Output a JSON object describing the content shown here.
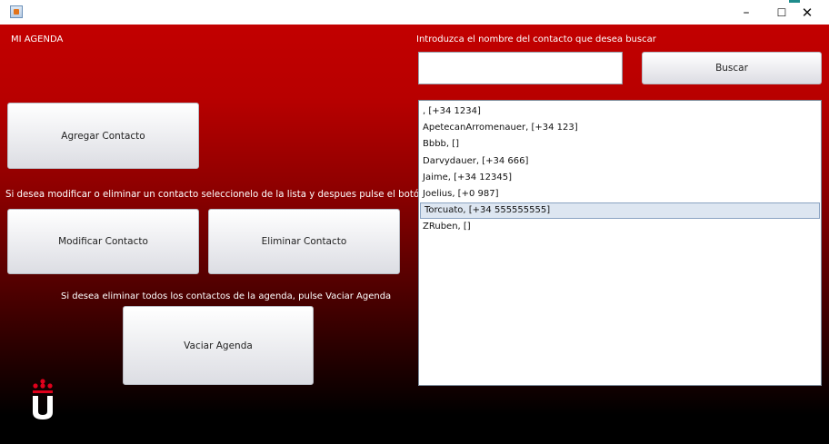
{
  "window": {
    "min_icon": "–",
    "max_icon": "☐",
    "close_icon": "✕"
  },
  "app_title": "MI AGENDA",
  "search": {
    "prompt": "Introduzca el nombre del contacto que desea buscar",
    "value": "",
    "button": "Buscar"
  },
  "buttons": {
    "add": "Agregar Contacto",
    "modify": "Modificar Contacto",
    "delete": "Eliminar Contacto",
    "empty": "Vaciar Agenda"
  },
  "instructions": {
    "modify_delete": "Si desea modificar o eliminar un contacto seleccionelo de la lista y despues pulse el botón",
    "empty": "Si desea eliminar todos los contactos de la agenda, pulse Vaciar Agenda"
  },
  "contacts": [
    ", [+34 1234]",
    "ApetecanArromenauer, [+34 123]",
    "Bbbb, []",
    "Darvydauer, [+34 666]",
    "Jaime, [+34 12345]",
    "Joelius, [+0 987]",
    "Torcuato, [+34 555555555]",
    "ZRuben, []"
  ],
  "selected_index": 6,
  "colors": {
    "bg_top": "#c20000",
    "bg_bottom": "#000000",
    "logo_red": "#e0001b"
  }
}
